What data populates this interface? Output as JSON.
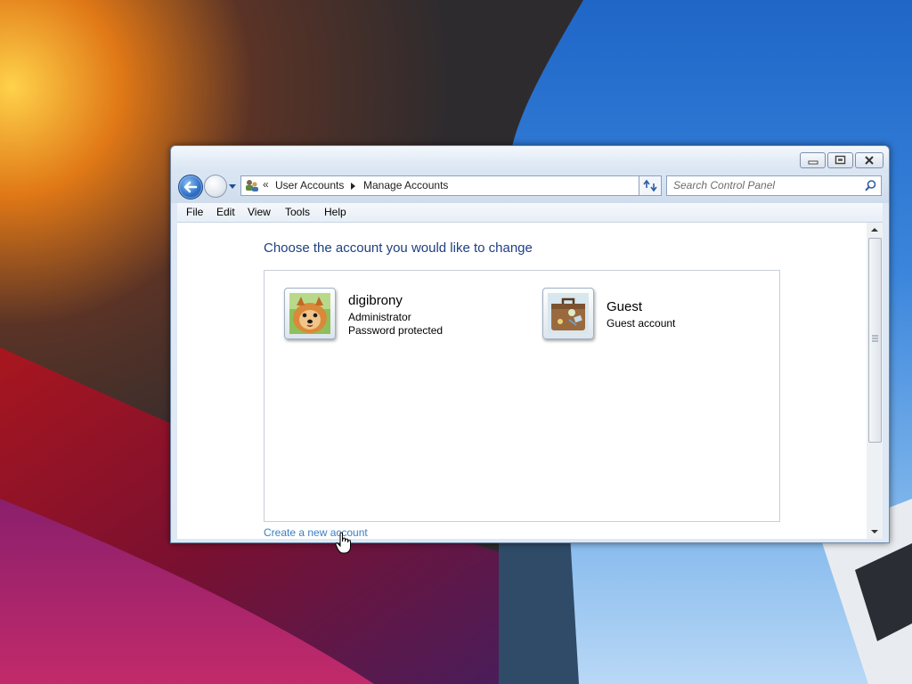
{
  "window": {
    "caption_buttons": [
      "minimize-icon",
      "maximize-icon",
      "close-icon"
    ]
  },
  "navigation": {
    "breadcrumb_prefix": "«",
    "breadcrumb": [
      "User Accounts",
      "Manage Accounts"
    ],
    "search_placeholder": "Search Control Panel"
  },
  "menu": [
    "File",
    "Edit",
    "View",
    "Tools",
    "Help"
  ],
  "content": {
    "heading": "Choose the account you would like to change",
    "accounts": [
      {
        "name": "digibrony",
        "lines": [
          "Administrator",
          "Password protected"
        ],
        "avatar": "pomeranian-dog-avatar"
      },
      {
        "name": "Guest",
        "lines": [
          "Guest account"
        ],
        "avatar": "suitcase-avatar"
      }
    ],
    "create_link": "Create a new account"
  },
  "colors": {
    "heading": "#1e3f81",
    "link": "#3a7fc4",
    "sky": "#3b86dc"
  }
}
